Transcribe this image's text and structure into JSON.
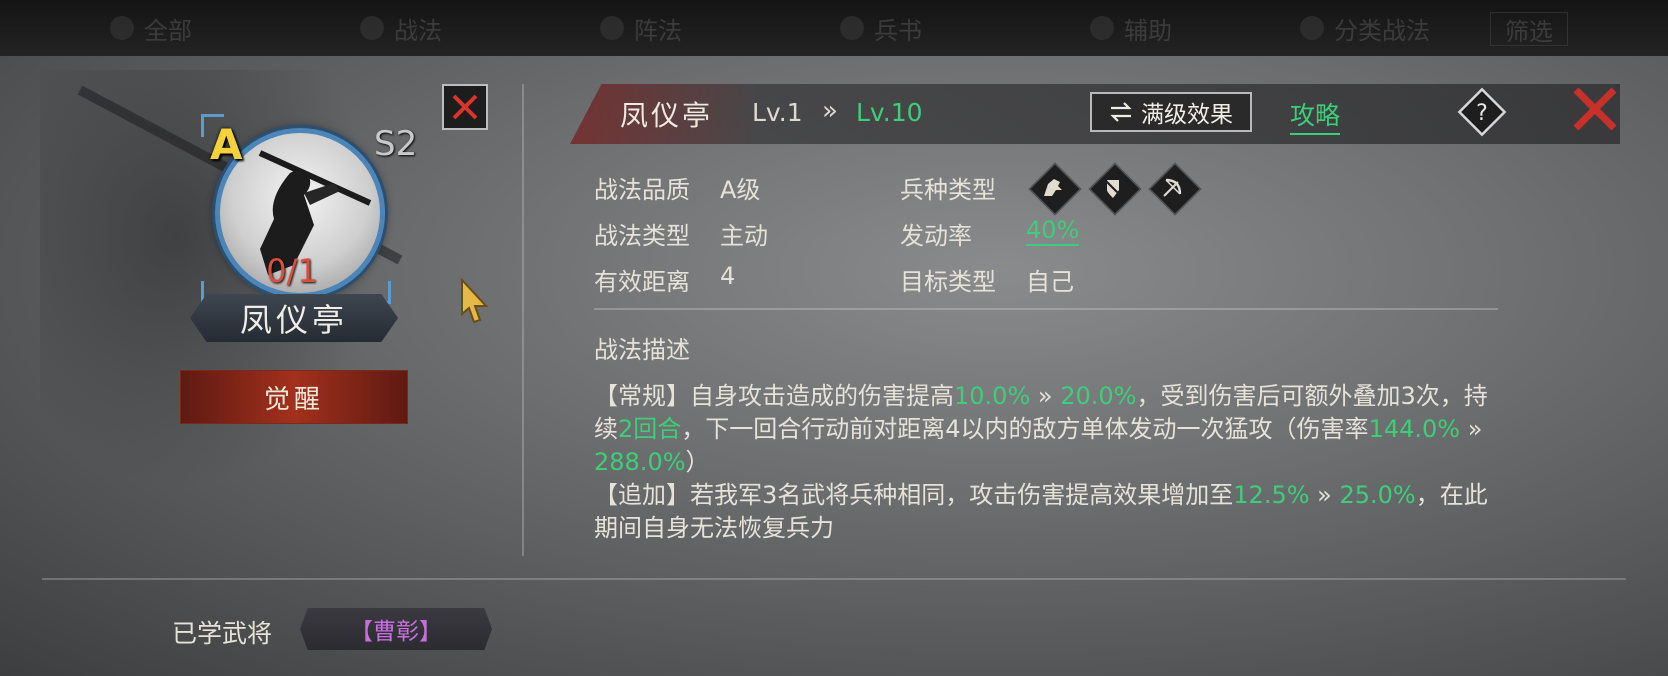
{
  "topbar": {
    "tabs": [
      "全部",
      "战法",
      "阵法",
      "兵书",
      "辅助",
      "分类战法"
    ],
    "right_button": "筛选"
  },
  "skill": {
    "grade": "A",
    "season": "S2",
    "uses": "0/1",
    "name": "凤仪亭",
    "awaken_label": "觉醒"
  },
  "header": {
    "title": "凤仪亭",
    "level_from": "Lv.1",
    "level_arrow": "»",
    "level_to": "Lv.10",
    "max_effect_label": "满级效果",
    "guide_label": "攻略"
  },
  "info": {
    "quality_label": "战法品质",
    "quality_value": "A级",
    "type_label": "战法类型",
    "type_value": "主动",
    "range_label": "有效距离",
    "range_value": "4",
    "troop_label": "兵种类型",
    "troop_icons": [
      "cavalry-icon",
      "shield-icon",
      "archer-icon"
    ],
    "rate_label": "发动率",
    "rate_value": "40%",
    "target_label": "目标类型",
    "target_value": "自己"
  },
  "description": {
    "title": "战法描述",
    "p1_a": "【常规】自身攻击造成的伤害提高",
    "p1_v1": "10.0%",
    "p1_arrow": " » ",
    "p1_v2": "20.0%",
    "p1_b": "，受到伤害后可额外叠加3次，持续",
    "p1_v3": "2回合",
    "p1_c": "，下一回合行动前对距离4以内的敌方单体发动一次猛攻（伤害率",
    "p1_v4": "144.0%",
    "p1_arrow2": " » ",
    "p1_v5": "288.0%",
    "p1_d": "）",
    "p2_a": "【追加】若我军3名武将兵种相同，攻击伤害提高效果增加至",
    "p2_v1": "12.5%",
    "p2_arrow": " » ",
    "p2_v2": "25.0%",
    "p2_b": "，在此期间自身无法恢复兵力"
  },
  "learned": {
    "label": "已学武将",
    "general": "【曹彰】"
  },
  "colors": {
    "accent_green": "#3ccf78",
    "grade_yellow": "#f5d13a",
    "uses_red": "#e14b3a",
    "general_purple": "#c86fe0",
    "close_red": "#c8302a"
  }
}
